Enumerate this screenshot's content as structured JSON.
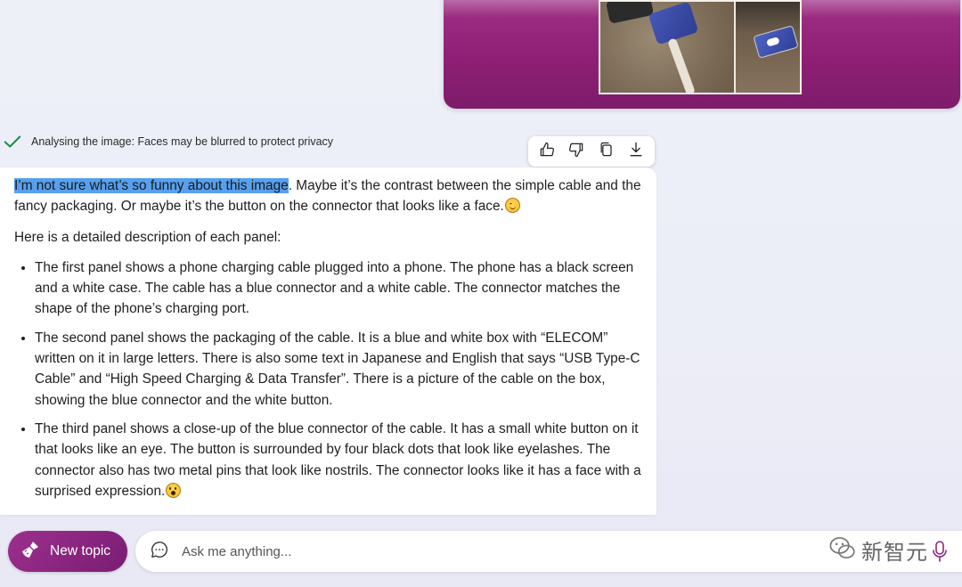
{
  "status": {
    "text": "Analysing the image: Faces may be blurred to protect privacy",
    "icon": "check-icon",
    "color": "#1e8e3e"
  },
  "toolbar": {
    "icons": [
      "thumbs-up-icon",
      "thumbs-down-icon",
      "copy-icon",
      "download-icon"
    ]
  },
  "response": {
    "highlighted": "I’m not sure what’s so funny about this image",
    "intro_rest": ". Maybe it’s the contrast between the simple cable and the fancy packaging. Or maybe it’s the button on the connector that looks like a face.",
    "lead": "Here is a detailed description of each panel:",
    "bullets": [
      "The first panel shows a phone charging cable plugged into a phone. The phone has a black screen and a white case. The cable has a blue connector and a white cable. The connector matches the shape of the phone’s charging port.",
      "The second panel shows the packaging of the cable. It is a blue and white box with “ELECOM” written on it in large letters. There is also some text in Japanese and English that says “USB Type-C Cable” and “High Speed Charging & Data Transfer”. There is a picture of the cable on the box, showing the blue connector and the white button.",
      "The third panel shows a close-up of the blue connector of the cable. It has a small white button on it that looks like an eye. The button is surrounded by four black dots that look like eyelashes. The connector also has two metal pins that look like nostrils. The connector looks like it has a face with a surprised expression."
    ],
    "emoji_1": "smiling-face-emoji",
    "emoji_2": "surprised-face-emoji"
  },
  "composer": {
    "new_topic_label": "New topic",
    "placeholder": "Ask me anything...",
    "accent": "#8e2584"
  },
  "watermark": {
    "text": "新智元"
  }
}
